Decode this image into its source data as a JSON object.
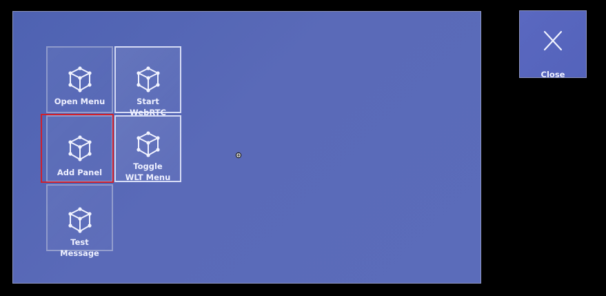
{
  "panel": {
    "buttons": [
      {
        "label": "Open Menu",
        "icon": "cube-icon"
      },
      {
        "label": "Start WebRTC",
        "icon": "cube-icon"
      },
      {
        "label": "Add Panel",
        "icon": "cube-icon"
      },
      {
        "label": "Toggle WLT Menu",
        "icon": "cube-icon"
      },
      {
        "label": "Test Message",
        "icon": "cube-icon"
      }
    ],
    "selected": "Add Panel"
  },
  "close": {
    "label": "Close",
    "icon": "close-icon"
  },
  "colors": {
    "panel_bg": "#5565b6",
    "selection": "#d0202c",
    "text": "#eef0ff"
  }
}
